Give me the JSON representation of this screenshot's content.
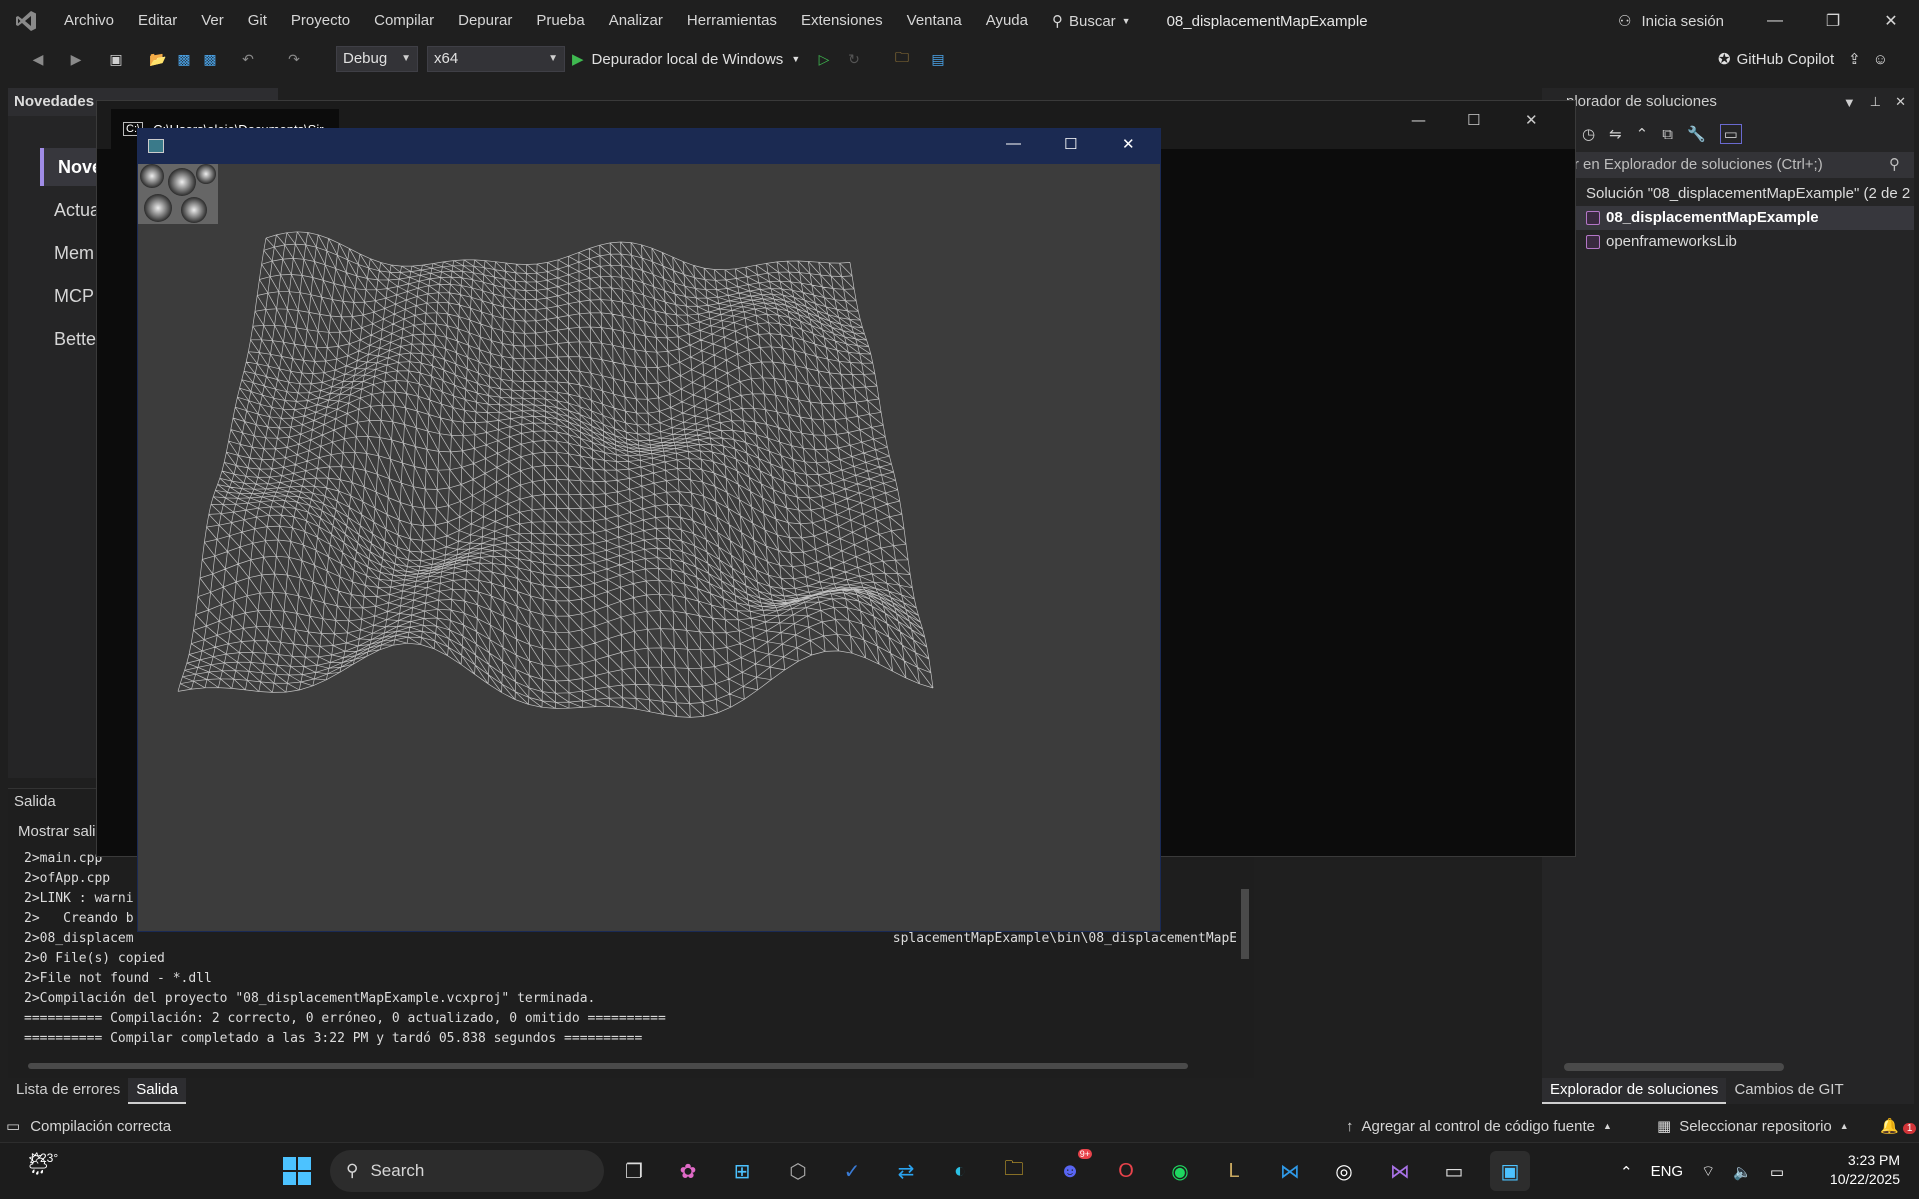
{
  "menubar": {
    "items": [
      "Archivo",
      "Editar",
      "Ver",
      "Git",
      "Proyecto",
      "Compilar",
      "Depurar",
      "Prueba",
      "Analizar",
      "Herramientas",
      "Extensiones",
      "Ventana",
      "Ayuda"
    ],
    "search_label": "Buscar",
    "window_title": "08_displacementMapExample",
    "signin_label": "Inicia sesión"
  },
  "toolbar": {
    "config": "Debug",
    "platform": "x64",
    "run_label": "Depurador local de Windows",
    "copilot_label": "GitHub Copilot"
  },
  "novedades": {
    "header": "Novedades",
    "items": [
      "Nove",
      "Actua",
      "Mem",
      "MCP",
      "Bette"
    ]
  },
  "console": {
    "tab_title": "C:\\Users\\alejo\\Documents\\Sir"
  },
  "salida": {
    "header": "Salida",
    "show_label": "Mostrar sali",
    "lines": [
      "2>main.cpp",
      "2>ofApp.cpp",
      "2>LINK : warni",
      "2>   Creando b",
      "2>08_displacem                                                                                                 splacementMapExample\\bin\\08_displacementMapE",
      "2>0 File(s) copied",
      "2>File not found - *.dll",
      "2>Compilación del proyecto \"08_displacementMapExample.vcxproj\" terminada.",
      "========== Compilación: 2 correcto, 0 erróneo, 0 actualizado, 0 omitido ==========",
      "========== Compilar completado a las 3:22 PM y tardó 05.838 segundos =========="
    ]
  },
  "bottom_tabs": [
    "Lista de errores",
    "Salida"
  ],
  "solution_explorer": {
    "header": "plorador de soluciones",
    "search_placeholder": "car en Explorador de soluciones (Ctrl+;)",
    "solution": "Solución \"08_displacementMapExample\"  (2 de 2",
    "projects": [
      "08_displacementMapExample",
      "openframeworksLib"
    ],
    "tabs": [
      "Explorador de soluciones",
      "Cambios de GIT"
    ]
  },
  "statusbar": {
    "left": "Compilación correcta",
    "git": "Agregar al control de código fuente",
    "repo": "Seleccionar repositorio",
    "notifications": "1"
  },
  "taskbar": {
    "temperature": "23°",
    "search_label": "Search",
    "badge": "9+",
    "lang": "ENG",
    "time": "3:23 PM",
    "date": "10/22/2025"
  },
  "colors": {
    "accent": "#a08ce6",
    "of_titlebar": "#1b2a52",
    "of_background": "#3c3c3c"
  }
}
